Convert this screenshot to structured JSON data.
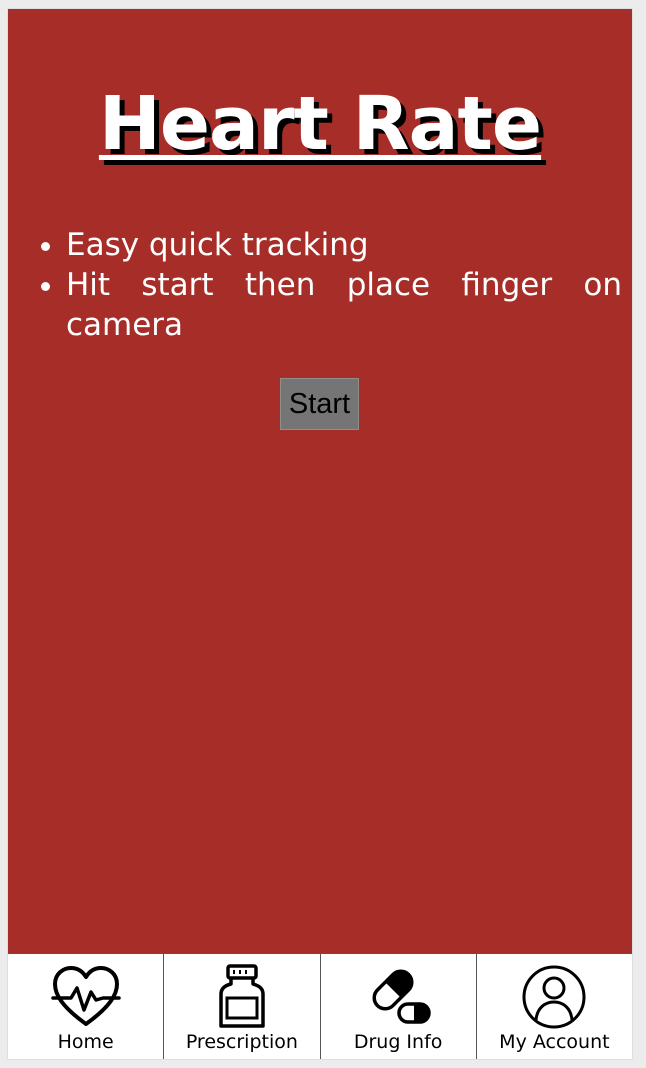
{
  "page": {
    "title": "Heart Rate",
    "bullets": [
      "Easy quick tracking",
      "Hit start then place finger on camera"
    ],
    "start_label": "Start"
  },
  "colors": {
    "background": "#a72d28",
    "text": "#ffffff",
    "button": "#757575"
  },
  "nav": {
    "items": [
      {
        "label": "Home",
        "icon": "heart-pulse-icon"
      },
      {
        "label": "Prescription",
        "icon": "pill-bottle-icon"
      },
      {
        "label": "Drug Info",
        "icon": "capsule-icon"
      },
      {
        "label": "My Account",
        "icon": "user-account-icon"
      }
    ]
  }
}
